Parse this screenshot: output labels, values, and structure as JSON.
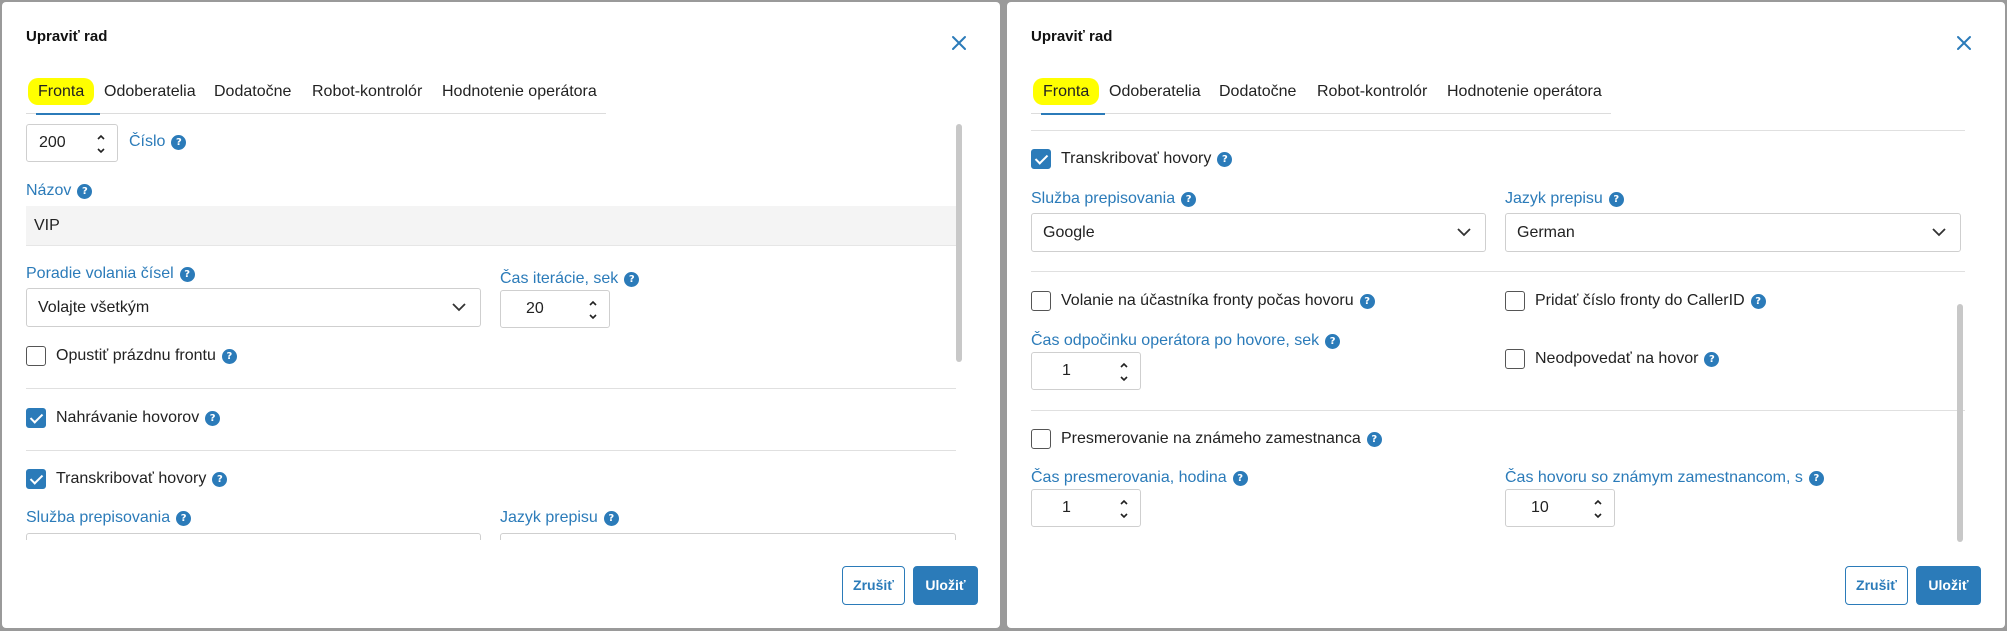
{
  "dialog": {
    "title": "Upraviť rad",
    "tabs": [
      "Fronta",
      "Odoberatelia",
      "Dodatočne",
      "Robot-kontrolór",
      "Hodnotenie operátora"
    ],
    "cancel_label": "Zrušiť",
    "save_label": "Uložiť",
    "help_glyph": "?"
  },
  "left": {
    "number_value": "200",
    "number_label": "Číslo",
    "name_label": "Názov",
    "name_value": "VIP",
    "call_order_label": "Poradie volania čísel",
    "call_order_value": "Volajte všetkým",
    "iteration_label": "Čas iterácie, sek",
    "iteration_value": "20",
    "leave_empty_label": "Opustiť prázdnu frontu",
    "recording_label": "Nahrávanie hovorov",
    "transcribe_label": "Transkribovať hovory",
    "service_label": "Služba prepisovania",
    "language_label": "Jazyk prepisu"
  },
  "right": {
    "transcribe_label": "Transkribovať hovory",
    "service_label": "Služba prepisovania",
    "service_value": "Google",
    "language_label": "Jazyk prepisu",
    "language_value": "German",
    "call_member_label": "Volanie na účastníka fronty počas hovoru",
    "add_queue_number_label": "Pridať číslo fronty do CallerID",
    "rest_time_label": "Čas odpočinku operátora po hovore, sek",
    "rest_time_value": "1",
    "no_answer_label": "Neodpovedať na hovor",
    "redirect_label": "Presmerovanie na známeho zamestnanca",
    "redirect_time_label": "Čas presmerovania, hodina",
    "redirect_time_value": "1",
    "known_call_time_label": "Čas hovoru so známym zamestnancom, s",
    "known_call_time_value": "10"
  },
  "colors": {
    "accent": "#2b7bb9",
    "active_tab_highlight": "#ffff00"
  }
}
